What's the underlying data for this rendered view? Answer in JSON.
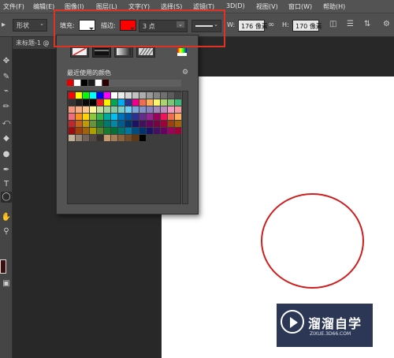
{
  "menu": [
    "文件(F)",
    "编辑(E)",
    "图像(I)",
    "图层(L)",
    "文字(Y)",
    "选择(S)",
    "滤镜(T)",
    "3D(D)",
    "视图(V)",
    "窗口(W)",
    "帮助(H)"
  ],
  "options": {
    "mode_value": "形状",
    "fill_label": "填充:",
    "fill_color": "#ffffff",
    "stroke_label": "描边:",
    "stroke_color": "#ff0000",
    "stroke_width": "3 点",
    "w_label": "W:",
    "w_value": "176 像素",
    "h_label": "H:",
    "h_value": "170 像素"
  },
  "document": {
    "tab_title": "未标题-1 @",
    "shape_stroke_color": "#d01e1e"
  },
  "panel": {
    "recent_title": "最近使用的颜色",
    "recent_colors": [
      "#e60000",
      "#ffffff",
      "#000000",
      "#1a1a1a",
      "#ffffff",
      "#2b0000"
    ],
    "type_buttons": [
      "no-color",
      "solid-color",
      "gradient",
      "pattern",
      "color-picker"
    ],
    "swatch_rows": [
      [
        "#ff0000",
        "#ffff00",
        "#00ff00",
        "#00ffff",
        "#0000ff",
        "#ff00ff",
        "#ffffff",
        "#ebebeb",
        "#d6d6d6",
        "#c2c2c2",
        "#adadad",
        "#999999",
        "#858585",
        "#707070",
        "#5c5c5c",
        "#474747"
      ],
      [
        "#333333",
        "#1f1f1f",
        "#0a0a0a",
        "#000000",
        "#ee1d24",
        "#fff200",
        "#00a651",
        "#00aeef",
        "#2e3192",
        "#ec008c",
        "#f26c4f",
        "#fbaf5d",
        "#fff568",
        "#acd373",
        "#7cc576",
        "#3cb878"
      ],
      [
        "#f7977a",
        "#f9ad81",
        "#fdc68a",
        "#fff79a",
        "#c4df9b",
        "#a3d39c",
        "#82ca9d",
        "#7bcdc8",
        "#6ecff6",
        "#7ea7d8",
        "#8493ca",
        "#8882be",
        "#a187be",
        "#bc8dbf",
        "#f49ac2",
        "#f6989d"
      ],
      [
        "#f26d7d",
        "#f7941d",
        "#ffd400",
        "#8dc63f",
        "#39b54a",
        "#00a99d",
        "#00bff3",
        "#0072bc",
        "#0054a6",
        "#2e3192",
        "#662d91",
        "#92278f",
        "#9e005d",
        "#ed145b",
        "#f26c4f",
        "#fbaf5d"
      ],
      [
        "#c1272d",
        "#c7601c",
        "#c29a00",
        "#67943a",
        "#1a7b30",
        "#007a6e",
        "#0088a9",
        "#005b8f",
        "#003471",
        "#1b1464",
        "#440e62",
        "#630460",
        "#7b0046",
        "#9e0039",
        "#a0410d",
        "#a36209"
      ],
      [
        "#9e0b0f",
        "#a0410d",
        "#a36209",
        "#aba000",
        "#598527",
        "#197b30",
        "#007236",
        "#00746b",
        "#0076a3",
        "#004b80",
        "#003471",
        "#1b1464",
        "#440e62",
        "#630460",
        "#9e005d",
        "#9e0039"
      ],
      [
        "#c7b299",
        "#998675",
        "#736357",
        "#534741",
        "#37302d",
        "#c69c6d",
        "#a67c52",
        "#8c6239",
        "#754c24",
        "#603913",
        "#000000"
      ]
    ]
  },
  "watermark": {
    "title": "溜溜自学",
    "url": "ZIXUE.3D66.COM"
  },
  "highlight_color": "#e03224"
}
